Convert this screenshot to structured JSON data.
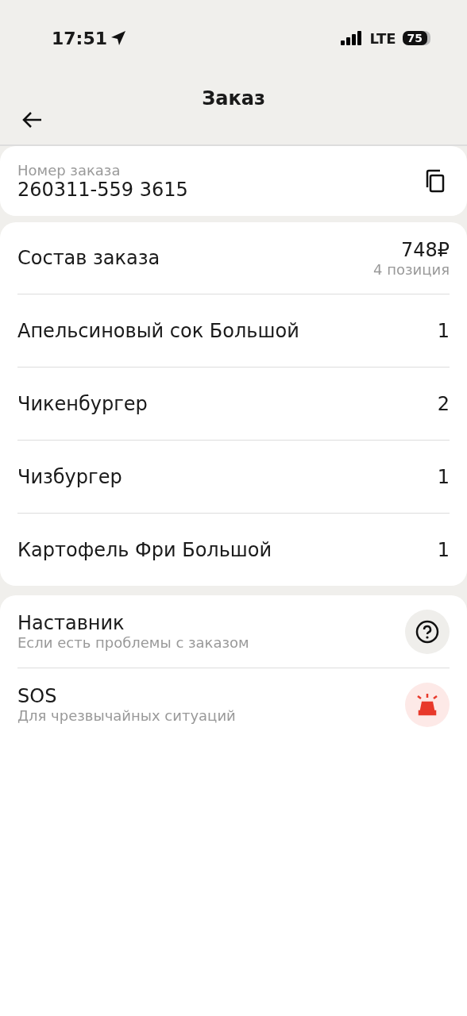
{
  "status_bar": {
    "time": "17:51",
    "network": "LTE",
    "battery": "75"
  },
  "header": {
    "title": "Заказ"
  },
  "order_number": {
    "label": "Номер заказа",
    "value": "260311-559 3615"
  },
  "order_contents": {
    "title": "Состав заказа",
    "total": "748₽",
    "count": "4 позиция",
    "items": [
      {
        "name": "Апельсиновый сок Большой",
        "qty": "1"
      },
      {
        "name": "Чикенбургер",
        "qty": "2"
      },
      {
        "name": "Чизбургер",
        "qty": "1"
      },
      {
        "name": "Картофель Фри Большой",
        "qty": "1"
      }
    ]
  },
  "support": [
    {
      "kind": "help",
      "title": "Наставник",
      "subtitle": "Если есть проблемы с заказом"
    },
    {
      "kind": "sos",
      "title": "SOS",
      "subtitle": "Для чрезвычайных ситуаций"
    }
  ]
}
